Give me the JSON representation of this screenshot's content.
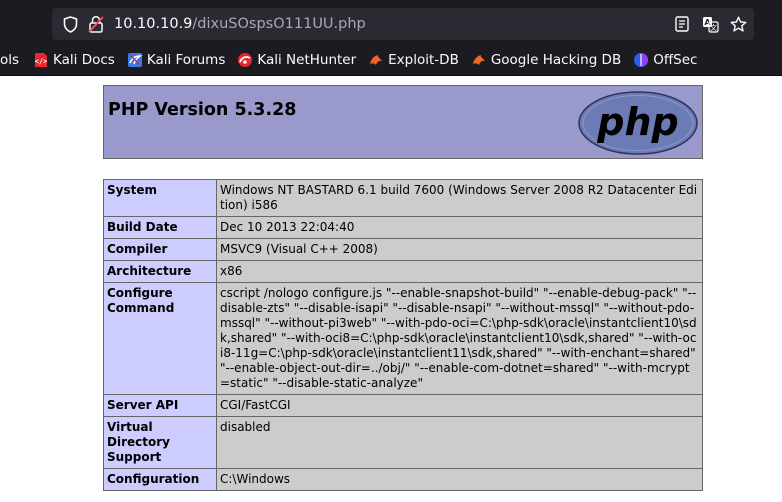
{
  "browser": {
    "url_host": "10.10.10.9",
    "url_path": "/dixuSOspsO111UU.php",
    "bookmarks": [
      {
        "label": "ols",
        "icon": "none"
      },
      {
        "label": "Kali Docs",
        "icon": "kali-docs-icon"
      },
      {
        "label": "Kali Forums",
        "icon": "kali-forums-icon"
      },
      {
        "label": "Kali NetHunter",
        "icon": "kali-nethunter-icon"
      },
      {
        "label": "Exploit-DB",
        "icon": "exploit-db-icon"
      },
      {
        "label": "Google Hacking DB",
        "icon": "google-hacking-db-icon"
      },
      {
        "label": "OffSec",
        "icon": "offsec-icon"
      }
    ]
  },
  "phpinfo": {
    "title": "PHP Version 5.3.28",
    "logo_text": "php",
    "rows": [
      {
        "key": "System",
        "value": "Windows NT BASTARD 6.1 build 7600 (Windows Server 2008 R2 Datacenter Edition) i586"
      },
      {
        "key": "Build Date",
        "value": "Dec 10 2013 22:04:40"
      },
      {
        "key": "Compiler",
        "value": "MSVC9 (Visual C++ 2008)"
      },
      {
        "key": "Architecture",
        "value": "x86"
      },
      {
        "key": "Configure Command",
        "value": "cscript /nologo configure.js \"--enable-snapshot-build\" \"--enable-debug-pack\" \"--disable-zts\" \"--disable-isapi\" \"--disable-nsapi\" \"--without-mssql\" \"--without-pdo-mssql\" \"--without-pi3web\" \"--with-pdo-oci=C:\\php-sdk\\oracle\\instantclient10\\sdk,shared\" \"--with-oci8=C:\\php-sdk\\oracle\\instantclient10\\sdk,shared\" \"--with-oci8-11g=C:\\php-sdk\\oracle\\instantclient11\\sdk,shared\" \"--with-enchant=shared\" \"--enable-object-out-dir=../obj/\" \"--enable-com-dotnet=shared\" \"--with-mcrypt=static\" \"--disable-static-analyze\""
      },
      {
        "key": "Server API",
        "value": "CGI/FastCGI"
      },
      {
        "key": "Virtual Directory Support",
        "value": "disabled"
      },
      {
        "key": "Configuration",
        "value": "C:\\Windows"
      }
    ]
  }
}
